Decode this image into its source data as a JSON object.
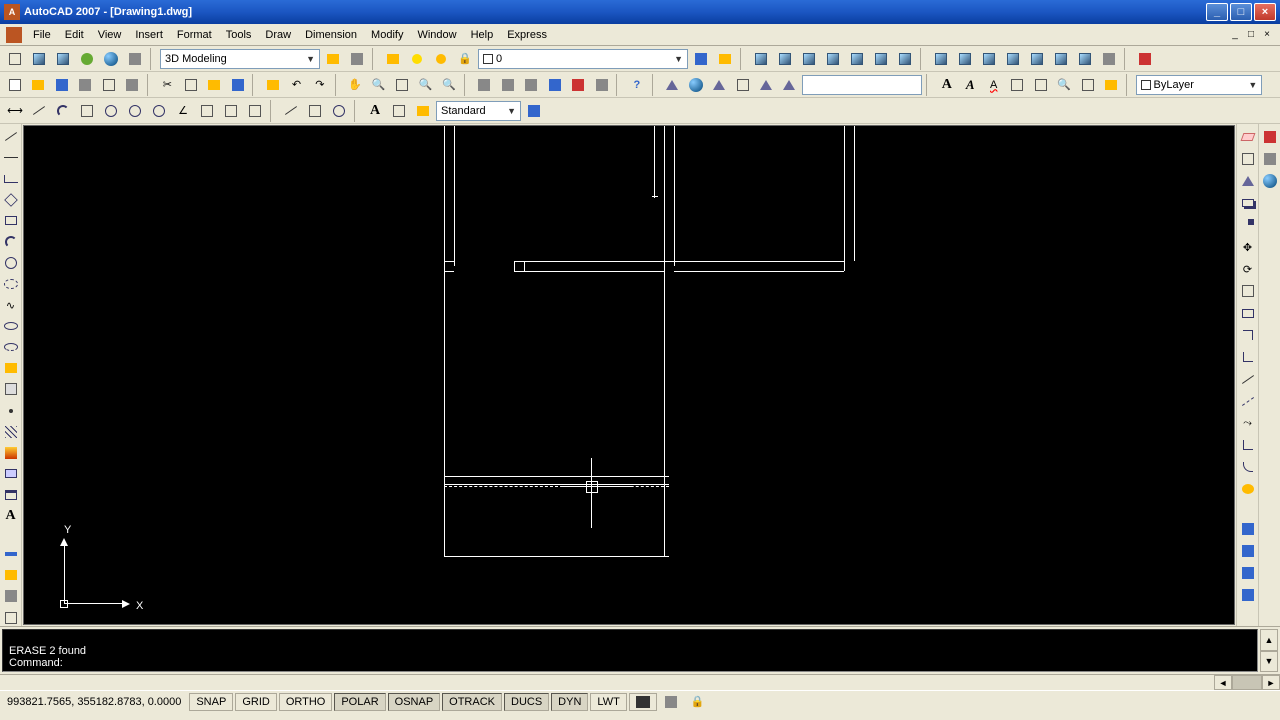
{
  "title": "AutoCAD 2007 - [Drawing1.dwg]",
  "menus": [
    "File",
    "Edit",
    "View",
    "Insert",
    "Format",
    "Tools",
    "Draw",
    "Dimension",
    "Modify",
    "Window",
    "Help",
    "Express"
  ],
  "workspace_select": "3D Modeling",
  "layer_current": "0",
  "linetype_select": "ByLayer",
  "textstyle_select": "Standard",
  "command_history": "ERASE 2 found",
  "command_prompt": "Command:",
  "status": {
    "coords": "993821.7565, 355182.8783, 0.0000",
    "toggles": [
      "SNAP",
      "GRID",
      "ORTHO",
      "POLAR",
      "OSNAP",
      "OTRACK",
      "DUCS",
      "DYN",
      "LWT"
    ],
    "active_toggles": [
      "POLAR",
      "OSNAP",
      "OTRACK",
      "DUCS",
      "DYN"
    ]
  },
  "ucs": {
    "x": "X",
    "y": "Y"
  },
  "text_icons": {
    "A": "A",
    "Ai": "A"
  },
  "search_placeholder": ""
}
